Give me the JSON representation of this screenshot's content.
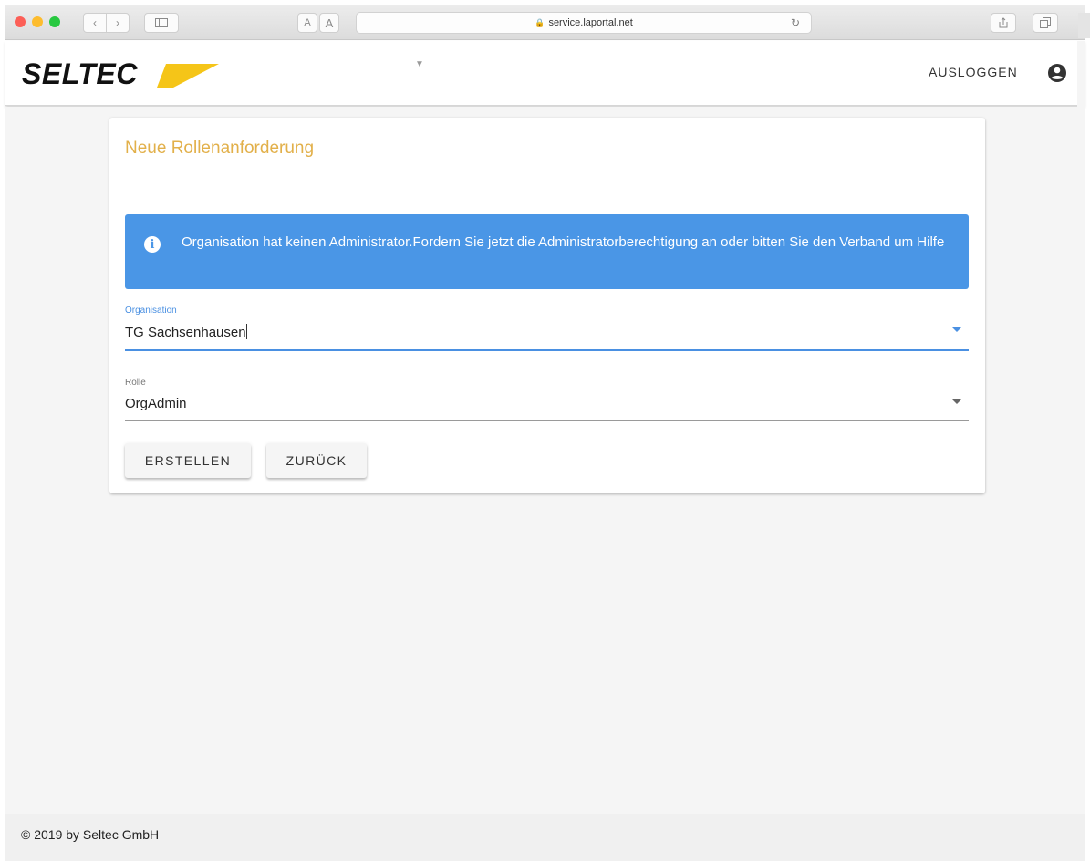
{
  "browser": {
    "url": "service.laportal.net",
    "font_small": "A",
    "font_large": "A"
  },
  "header": {
    "logo_text": "SELTEC",
    "logout_label": "AUSLOGGEN"
  },
  "card": {
    "title": "Neue Rollenanforderung",
    "alert_text": "Organisation hat keinen Administrator.Fordern Sie jetzt die Administratorberechtigung an oder bitten Sie den Verband um Hilfe",
    "organisation": {
      "label": "Organisation",
      "value": "TG Sachsenhausen"
    },
    "role": {
      "label": "Rolle",
      "value": "OrgAdmin"
    },
    "buttons": {
      "create": "ERSTELLEN",
      "back": "ZURÜCK"
    }
  },
  "footer": {
    "text": "© 2019 by Seltec GmbH"
  },
  "colors": {
    "accent_title": "#e2b04a",
    "alert_bg": "#4a96e6",
    "focus_underline": "#4a90e2",
    "logo_swoosh": "#f5c518"
  }
}
